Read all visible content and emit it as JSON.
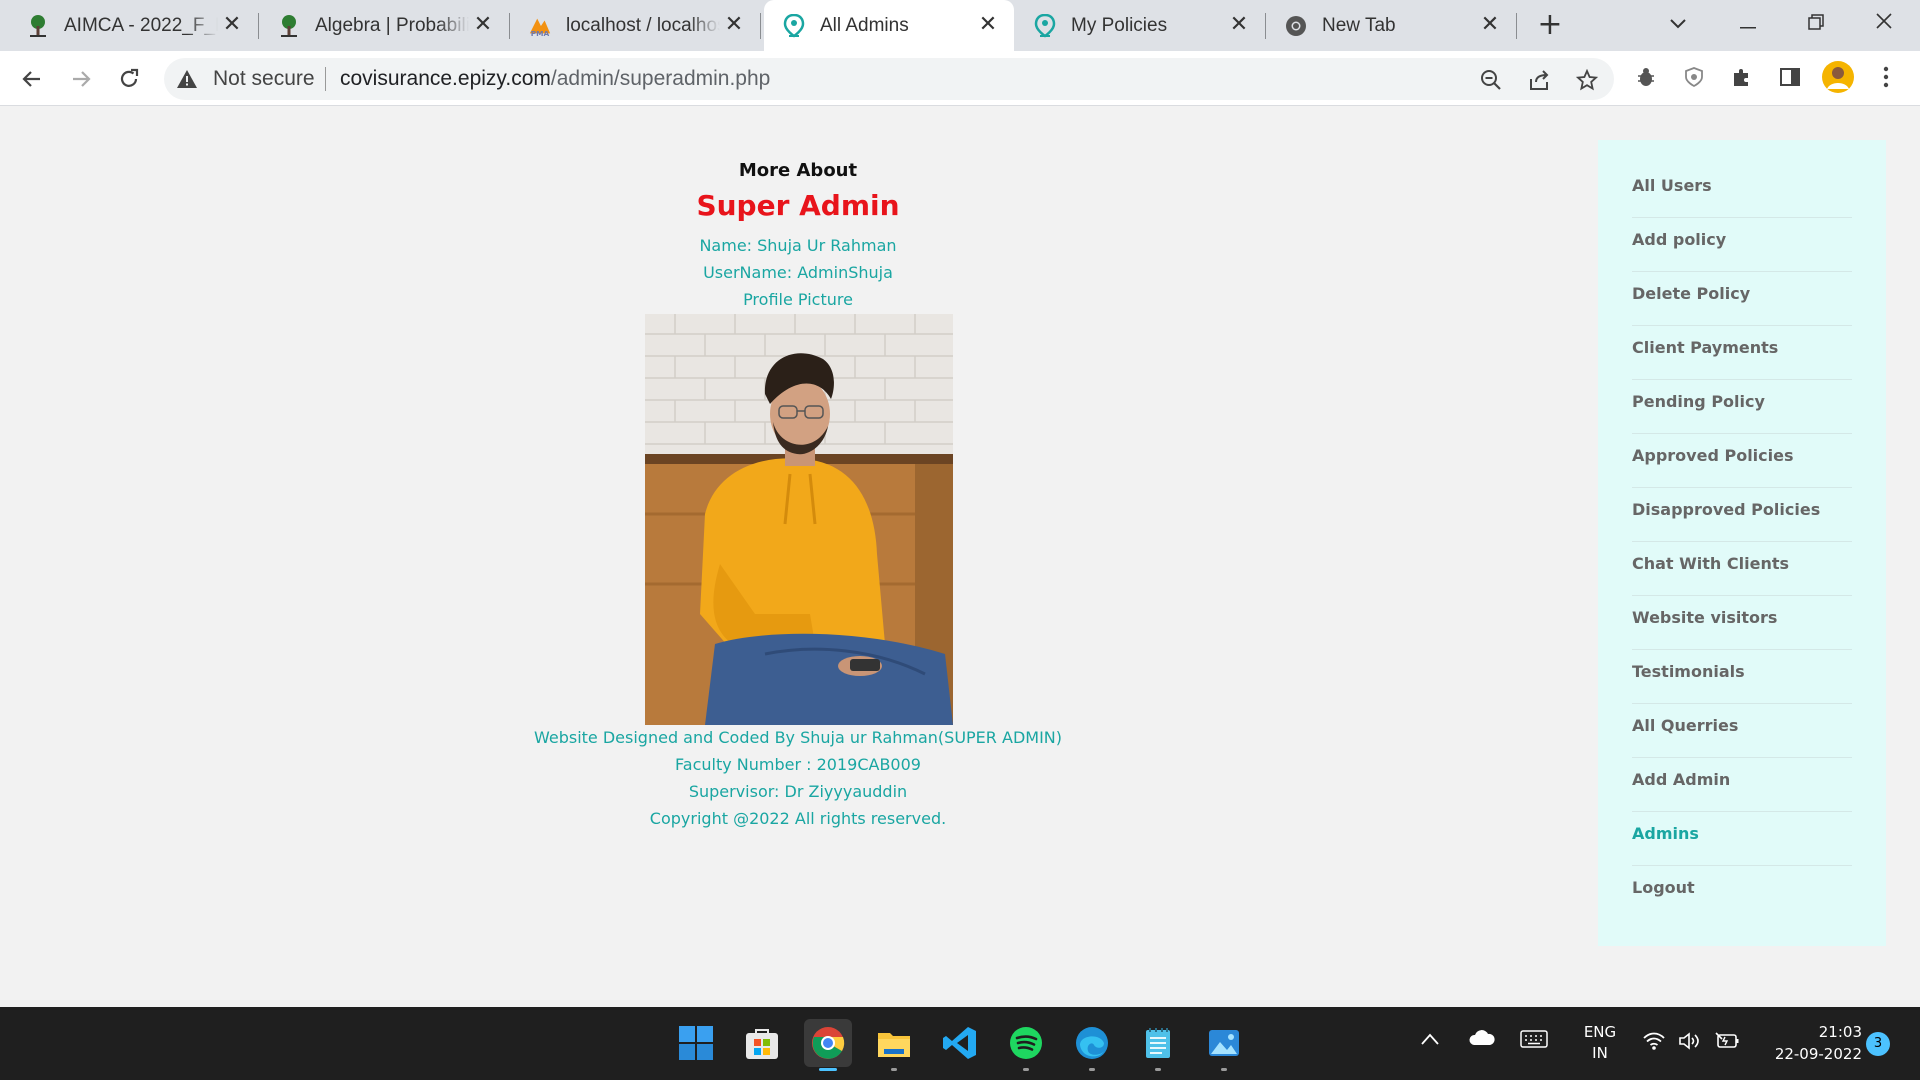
{
  "browser": {
    "tabs": [
      {
        "title": "AIMCA - 2022_F_Batch",
        "icon": "tree-logo-icon",
        "active": false
      },
      {
        "title": "Algebra | Probability",
        "icon": "tree-logo-icon",
        "active": false
      },
      {
        "title": "localhost / localhost",
        "icon": "phpmyadmin-icon",
        "active": false
      },
      {
        "title": "All Admins",
        "icon": "shield-logo-icon",
        "active": true
      },
      {
        "title": "My Policies",
        "icon": "shield-logo-icon",
        "active": false
      },
      {
        "title": "New Tab",
        "icon": "chrome-icon",
        "active": false
      }
    ],
    "security_label": "Not secure",
    "url_domain": "covisurance.epizy.com",
    "url_path": "/admin/superadmin.php"
  },
  "about": {
    "heading": "More About",
    "title": "Super Admin",
    "name": "Name: Shuja Ur Rahman",
    "username": "UserName: AdminShuja",
    "profile_label": "Profile Picture",
    "credit": "Website Designed and Coded By Shuja ur Rahman(SUPER ADMIN)",
    "faculty": "Faculty Number : 2019CAB009",
    "supervisor": "Supervisor: Dr Ziyyyauddin",
    "copyright": "Copyright @2022 All rights reserved."
  },
  "sidebar": {
    "items": [
      {
        "label": "All Users"
      },
      {
        "label": "Add policy"
      },
      {
        "label": "Delete Policy"
      },
      {
        "label": "Client Payments"
      },
      {
        "label": "Pending Policy"
      },
      {
        "label": "Approved Policies"
      },
      {
        "label": "Disapproved Policies"
      },
      {
        "label": "Chat With Clients"
      },
      {
        "label": "Website visitors"
      },
      {
        "label": "Testimonials"
      },
      {
        "label": "All Querries"
      },
      {
        "label": "Add Admin"
      },
      {
        "label": "Admins",
        "active": true
      },
      {
        "label": "Logout"
      }
    ]
  },
  "taskbar": {
    "apps": [
      "start-icon",
      "store-icon",
      "chrome-icon",
      "file-explorer-icon",
      "vscode-icon",
      "spotify-icon",
      "edge-icon",
      "notepad-icon",
      "photos-icon"
    ],
    "language": "ENG",
    "region": "IN",
    "time": "21:03",
    "date": "22-09-2022",
    "notification_count": "3"
  },
  "colors": {
    "accent_teal": "#1aa6a2",
    "title_red": "#e8141b",
    "sidebar_bg": "#e1fbf9"
  }
}
